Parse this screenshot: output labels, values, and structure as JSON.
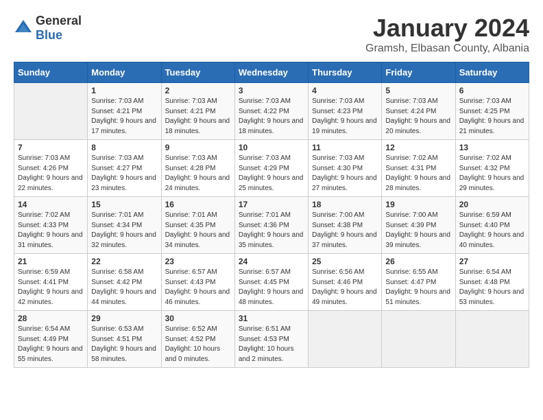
{
  "header": {
    "logo_general": "General",
    "logo_blue": "Blue",
    "month_title": "January 2024",
    "location": "Gramsh, Elbasan County, Albania"
  },
  "days_of_week": [
    "Sunday",
    "Monday",
    "Tuesday",
    "Wednesday",
    "Thursday",
    "Friday",
    "Saturday"
  ],
  "weeks": [
    [
      {
        "day": "",
        "sunrise": "",
        "sunset": "",
        "daylight": ""
      },
      {
        "day": "1",
        "sunrise": "Sunrise: 7:03 AM",
        "sunset": "Sunset: 4:21 PM",
        "daylight": "Daylight: 9 hours and 17 minutes."
      },
      {
        "day": "2",
        "sunrise": "Sunrise: 7:03 AM",
        "sunset": "Sunset: 4:21 PM",
        "daylight": "Daylight: 9 hours and 18 minutes."
      },
      {
        "day": "3",
        "sunrise": "Sunrise: 7:03 AM",
        "sunset": "Sunset: 4:22 PM",
        "daylight": "Daylight: 9 hours and 18 minutes."
      },
      {
        "day": "4",
        "sunrise": "Sunrise: 7:03 AM",
        "sunset": "Sunset: 4:23 PM",
        "daylight": "Daylight: 9 hours and 19 minutes."
      },
      {
        "day": "5",
        "sunrise": "Sunrise: 7:03 AM",
        "sunset": "Sunset: 4:24 PM",
        "daylight": "Daylight: 9 hours and 20 minutes."
      },
      {
        "day": "6",
        "sunrise": "Sunrise: 7:03 AM",
        "sunset": "Sunset: 4:25 PM",
        "daylight": "Daylight: 9 hours and 21 minutes."
      }
    ],
    [
      {
        "day": "7",
        "sunrise": "Sunrise: 7:03 AM",
        "sunset": "Sunset: 4:26 PM",
        "daylight": "Daylight: 9 hours and 22 minutes."
      },
      {
        "day": "8",
        "sunrise": "Sunrise: 7:03 AM",
        "sunset": "Sunset: 4:27 PM",
        "daylight": "Daylight: 9 hours and 23 minutes."
      },
      {
        "day": "9",
        "sunrise": "Sunrise: 7:03 AM",
        "sunset": "Sunset: 4:28 PM",
        "daylight": "Daylight: 9 hours and 24 minutes."
      },
      {
        "day": "10",
        "sunrise": "Sunrise: 7:03 AM",
        "sunset": "Sunset: 4:29 PM",
        "daylight": "Daylight: 9 hours and 25 minutes."
      },
      {
        "day": "11",
        "sunrise": "Sunrise: 7:03 AM",
        "sunset": "Sunset: 4:30 PM",
        "daylight": "Daylight: 9 hours and 27 minutes."
      },
      {
        "day": "12",
        "sunrise": "Sunrise: 7:02 AM",
        "sunset": "Sunset: 4:31 PM",
        "daylight": "Daylight: 9 hours and 28 minutes."
      },
      {
        "day": "13",
        "sunrise": "Sunrise: 7:02 AM",
        "sunset": "Sunset: 4:32 PM",
        "daylight": "Daylight: 9 hours and 29 minutes."
      }
    ],
    [
      {
        "day": "14",
        "sunrise": "Sunrise: 7:02 AM",
        "sunset": "Sunset: 4:33 PM",
        "daylight": "Daylight: 9 hours and 31 minutes."
      },
      {
        "day": "15",
        "sunrise": "Sunrise: 7:01 AM",
        "sunset": "Sunset: 4:34 PM",
        "daylight": "Daylight: 9 hours and 32 minutes."
      },
      {
        "day": "16",
        "sunrise": "Sunrise: 7:01 AM",
        "sunset": "Sunset: 4:35 PM",
        "daylight": "Daylight: 9 hours and 34 minutes."
      },
      {
        "day": "17",
        "sunrise": "Sunrise: 7:01 AM",
        "sunset": "Sunset: 4:36 PM",
        "daylight": "Daylight: 9 hours and 35 minutes."
      },
      {
        "day": "18",
        "sunrise": "Sunrise: 7:00 AM",
        "sunset": "Sunset: 4:38 PM",
        "daylight": "Daylight: 9 hours and 37 minutes."
      },
      {
        "day": "19",
        "sunrise": "Sunrise: 7:00 AM",
        "sunset": "Sunset: 4:39 PM",
        "daylight": "Daylight: 9 hours and 39 minutes."
      },
      {
        "day": "20",
        "sunrise": "Sunrise: 6:59 AM",
        "sunset": "Sunset: 4:40 PM",
        "daylight": "Daylight: 9 hours and 40 minutes."
      }
    ],
    [
      {
        "day": "21",
        "sunrise": "Sunrise: 6:59 AM",
        "sunset": "Sunset: 4:41 PM",
        "daylight": "Daylight: 9 hours and 42 minutes."
      },
      {
        "day": "22",
        "sunrise": "Sunrise: 6:58 AM",
        "sunset": "Sunset: 4:42 PM",
        "daylight": "Daylight: 9 hours and 44 minutes."
      },
      {
        "day": "23",
        "sunrise": "Sunrise: 6:57 AM",
        "sunset": "Sunset: 4:43 PM",
        "daylight": "Daylight: 9 hours and 46 minutes."
      },
      {
        "day": "24",
        "sunrise": "Sunrise: 6:57 AM",
        "sunset": "Sunset: 4:45 PM",
        "daylight": "Daylight: 9 hours and 48 minutes."
      },
      {
        "day": "25",
        "sunrise": "Sunrise: 6:56 AM",
        "sunset": "Sunset: 4:46 PM",
        "daylight": "Daylight: 9 hours and 49 minutes."
      },
      {
        "day": "26",
        "sunrise": "Sunrise: 6:55 AM",
        "sunset": "Sunset: 4:47 PM",
        "daylight": "Daylight: 9 hours and 51 minutes."
      },
      {
        "day": "27",
        "sunrise": "Sunrise: 6:54 AM",
        "sunset": "Sunset: 4:48 PM",
        "daylight": "Daylight: 9 hours and 53 minutes."
      }
    ],
    [
      {
        "day": "28",
        "sunrise": "Sunrise: 6:54 AM",
        "sunset": "Sunset: 4:49 PM",
        "daylight": "Daylight: 9 hours and 55 minutes."
      },
      {
        "day": "29",
        "sunrise": "Sunrise: 6:53 AM",
        "sunset": "Sunset: 4:51 PM",
        "daylight": "Daylight: 9 hours and 58 minutes."
      },
      {
        "day": "30",
        "sunrise": "Sunrise: 6:52 AM",
        "sunset": "Sunset: 4:52 PM",
        "daylight": "Daylight: 10 hours and 0 minutes."
      },
      {
        "day": "31",
        "sunrise": "Sunrise: 6:51 AM",
        "sunset": "Sunset: 4:53 PM",
        "daylight": "Daylight: 10 hours and 2 minutes."
      },
      {
        "day": "",
        "sunrise": "",
        "sunset": "",
        "daylight": ""
      },
      {
        "day": "",
        "sunrise": "",
        "sunset": "",
        "daylight": ""
      },
      {
        "day": "",
        "sunrise": "",
        "sunset": "",
        "daylight": ""
      }
    ]
  ]
}
